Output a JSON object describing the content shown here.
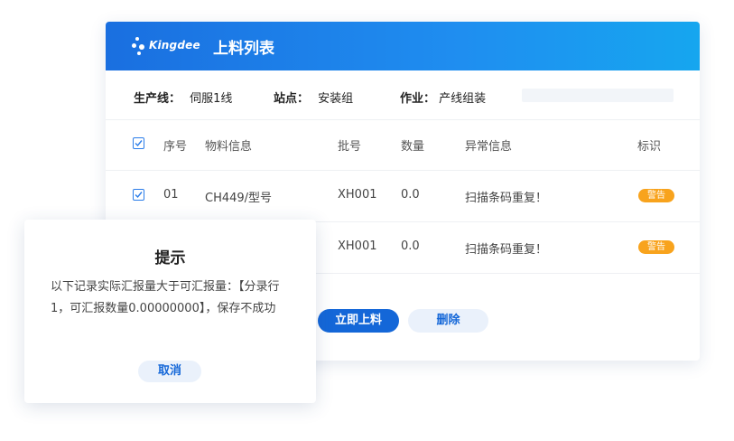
{
  "header": {
    "brand": "Kingdee",
    "title": "上料列表"
  },
  "filters": {
    "line_label": "生产线：",
    "line_value": "伺服1线",
    "station_label": "站点：",
    "station_value": "安装组",
    "job_label": "作业：",
    "job_value": "产线组装"
  },
  "table": {
    "columns": [
      "序号",
      "物料信息",
      "批号",
      "数量",
      "异常信息",
      "标识"
    ],
    "rows": [
      {
        "seq": "01",
        "material": "CH449/型号",
        "batch": "XH001",
        "qty": "0.0",
        "error": "扫描条码重复！",
        "tag": "警告"
      },
      {
        "seq": "",
        "material": "",
        "batch": "XH001",
        "qty": "0.0",
        "error": "扫描条码重复！",
        "tag": "警告"
      }
    ]
  },
  "actions": {
    "load_now": "立即上料",
    "delete": "删除"
  },
  "dialog": {
    "title": "提示",
    "message": "以下记录实际汇报量大于可汇报量：【分录行1，可汇报数量0.00000000】，保存不成功",
    "cancel": "取消"
  },
  "colors": {
    "header_blue": "#1a6fe0",
    "primary": "#1467d8",
    "warning": "#f8a31d"
  }
}
